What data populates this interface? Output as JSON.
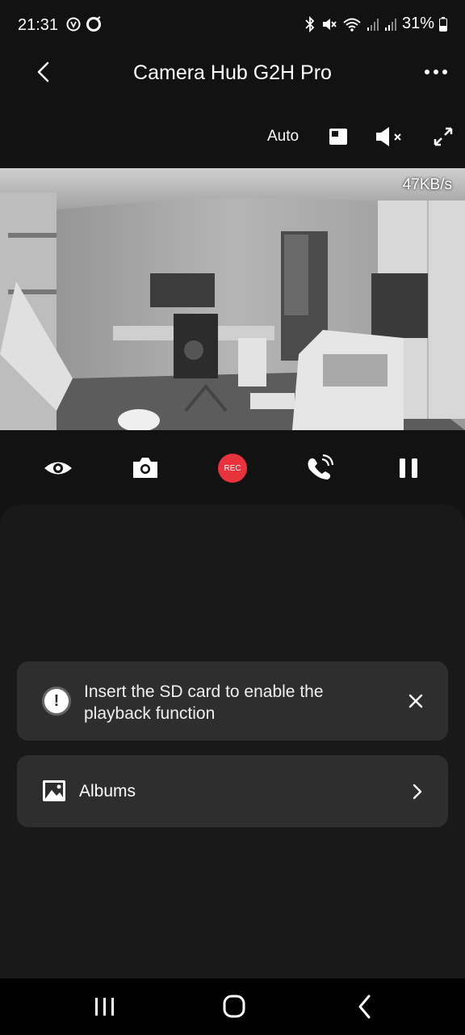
{
  "status_bar": {
    "time": "21:31",
    "battery": "31%",
    "icons": [
      "data-saver-icon",
      "circle-app-icon",
      "bluetooth-icon",
      "mute-icon",
      "wifi-icon",
      "signal-icon",
      "signal-icon",
      "battery-icon"
    ]
  },
  "header": {
    "title": "Camera Hub G2H Pro",
    "back_icon": "chevron-left-icon",
    "more_icon": "more-dots-icon"
  },
  "controls": {
    "quality_label": "Auto",
    "icons": [
      "picture-in-picture-icon",
      "speaker-muted-icon",
      "fullscreen-icon"
    ]
  },
  "video": {
    "bitrate": "47KB/s"
  },
  "actions": {
    "rec_label": "REC",
    "icons": [
      "eye-icon",
      "camera-icon",
      "rec-icon",
      "phone-call-icon",
      "pause-icon"
    ],
    "rec_color": "#e8323c"
  },
  "sd_notice": {
    "text": "Insert the SD card to enable the playback function",
    "icon": "alert-icon"
  },
  "albums": {
    "label": "Albums",
    "icon": "image-icon"
  },
  "nav_bar": {
    "icons": [
      "recent-apps-icon",
      "home-icon",
      "back-icon"
    ]
  },
  "colors": {
    "background": "#121212",
    "panel": "#191919",
    "card": "#2e2e2e"
  }
}
